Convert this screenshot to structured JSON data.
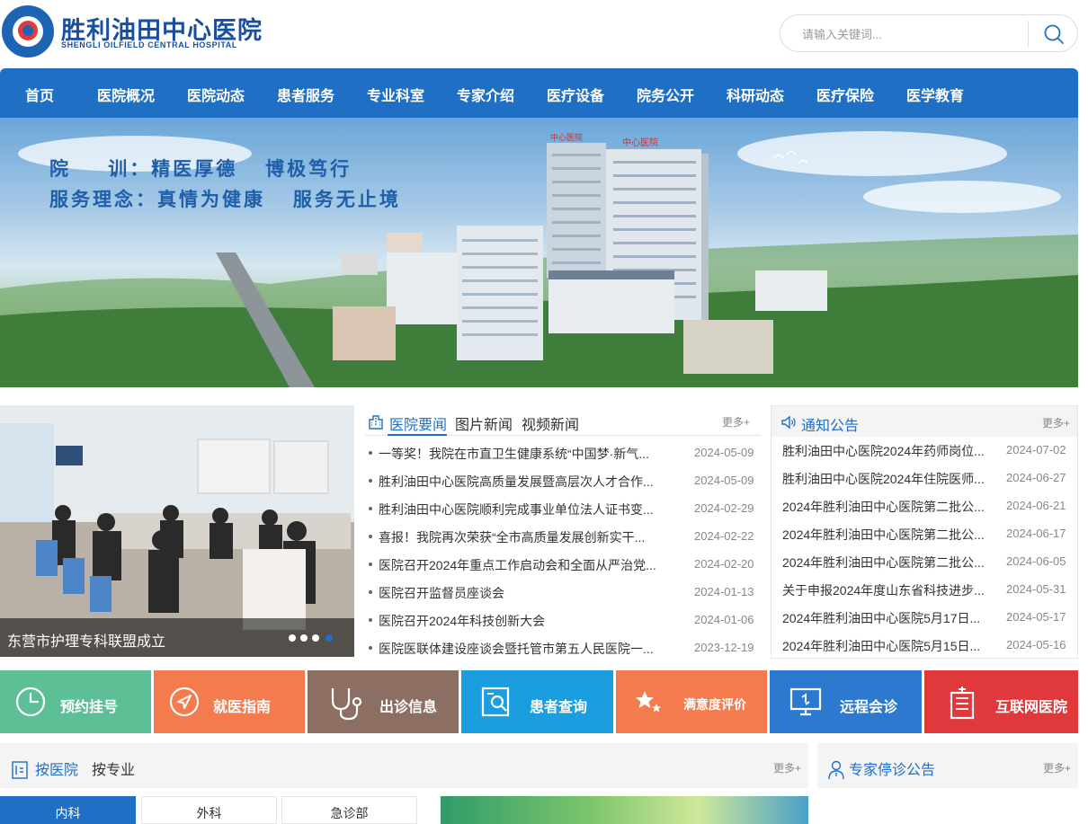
{
  "header": {
    "logo_cn": "胜利油田中心医院",
    "logo_en": "SHENGLI OILFIELD CENTRAL HOSPITAL",
    "search_placeholder": "请输入关键词..."
  },
  "nav": [
    "首页",
    "医院概况",
    "医院动态",
    "患者服务",
    "专业科室",
    "专家介绍",
    "医疗设备",
    "院务公开",
    "科研动态",
    "医疗保险",
    "医学教育"
  ],
  "banner": {
    "line1": "院    训：精医厚德   博极笃行",
    "line2": "服务理念：真情为健康   服务无止境",
    "building_sign_1": "中心医院",
    "building_sign_2": "中心医院"
  },
  "slider": {
    "caption": "东营市护理专科联盟成立",
    "dots": 4,
    "active_dot": 4
  },
  "news": {
    "tabs": [
      "医院要闻",
      "图片新闻",
      "视频新闻"
    ],
    "active_tab": 0,
    "more": "更多+",
    "items": [
      {
        "title": "一等奖！我院在市直卫生健康系统“中国梦·新气...",
        "date": "2024-05-09"
      },
      {
        "title": "胜利油田中心医院高质量发展暨高层次人才合作...",
        "date": "2024-05-09"
      },
      {
        "title": "胜利油田中心医院顺利完成事业单位法人证书变...",
        "date": "2024-02-29"
      },
      {
        "title": "喜报！我院再次荣获“全市高质量发展创新实干...",
        "date": "2024-02-22"
      },
      {
        "title": "医院召开2024年重点工作启动会和全面从严治党...",
        "date": "2024-02-20"
      },
      {
        "title": "医院召开监督员座谈会",
        "date": "2024-01-13"
      },
      {
        "title": "医院召开2024年科技创新大会",
        "date": "2024-01-06"
      },
      {
        "title": "医院医联体建设座谈会暨托管市第五人民医院一...",
        "date": "2023-12-19"
      }
    ]
  },
  "notices": {
    "title": "通知公告",
    "more": "更多+",
    "items": [
      {
        "title": "胜利油田中心医院2024年药师岗位...",
        "date": "2024-07-02"
      },
      {
        "title": "胜利油田中心医院2024年住院医师...",
        "date": "2024-06-27"
      },
      {
        "title": "2024年胜利油田中心医院第二批公...",
        "date": "2024-06-21"
      },
      {
        "title": "2024年胜利油田中心医院第二批公...",
        "date": "2024-06-17"
      },
      {
        "title": "2024年胜利油田中心医院第二批公...",
        "date": "2024-06-05"
      },
      {
        "title": "关于申报2024年度山东省科技进步...",
        "date": "2024-05-31"
      },
      {
        "title": "2024年胜利油田中心医院5月17日...",
        "date": "2024-05-17"
      },
      {
        "title": "2024年胜利油田中心医院5月15日...",
        "date": "2024-05-16"
      }
    ]
  },
  "tiles": [
    {
      "label": "预约挂号",
      "color": "#5cbf96",
      "icon": "clock-icon"
    },
    {
      "label": "就医指南",
      "color": "#f47b4d",
      "icon": "navigation-icon"
    },
    {
      "label": "出诊信息",
      "color": "#8c6e62",
      "icon": "stethoscope-icon"
    },
    {
      "label": "患者查询",
      "color": "#1b9ee0",
      "icon": "search-document-icon"
    },
    {
      "label": "满意度评价",
      "color": "#f47b4d",
      "icon": "stars-icon"
    },
    {
      "label": "远程会诊",
      "color": "#2d79cf",
      "icon": "monitor-icon"
    },
    {
      "label": "互联网医院",
      "color": "#e0383b",
      "icon": "hospital-building-icon"
    }
  ],
  "departments": {
    "tabs": [
      "按医院",
      "按专业"
    ],
    "more": "更多+",
    "subtabs": [
      "内科",
      "外科",
      "急诊部"
    ],
    "active_subtab": 0
  },
  "expert": {
    "title": "专家停诊公告",
    "more": "更多+"
  },
  "colors": {
    "brand_blue": "#1f6fc4",
    "logo_red": "#e63a3a"
  }
}
